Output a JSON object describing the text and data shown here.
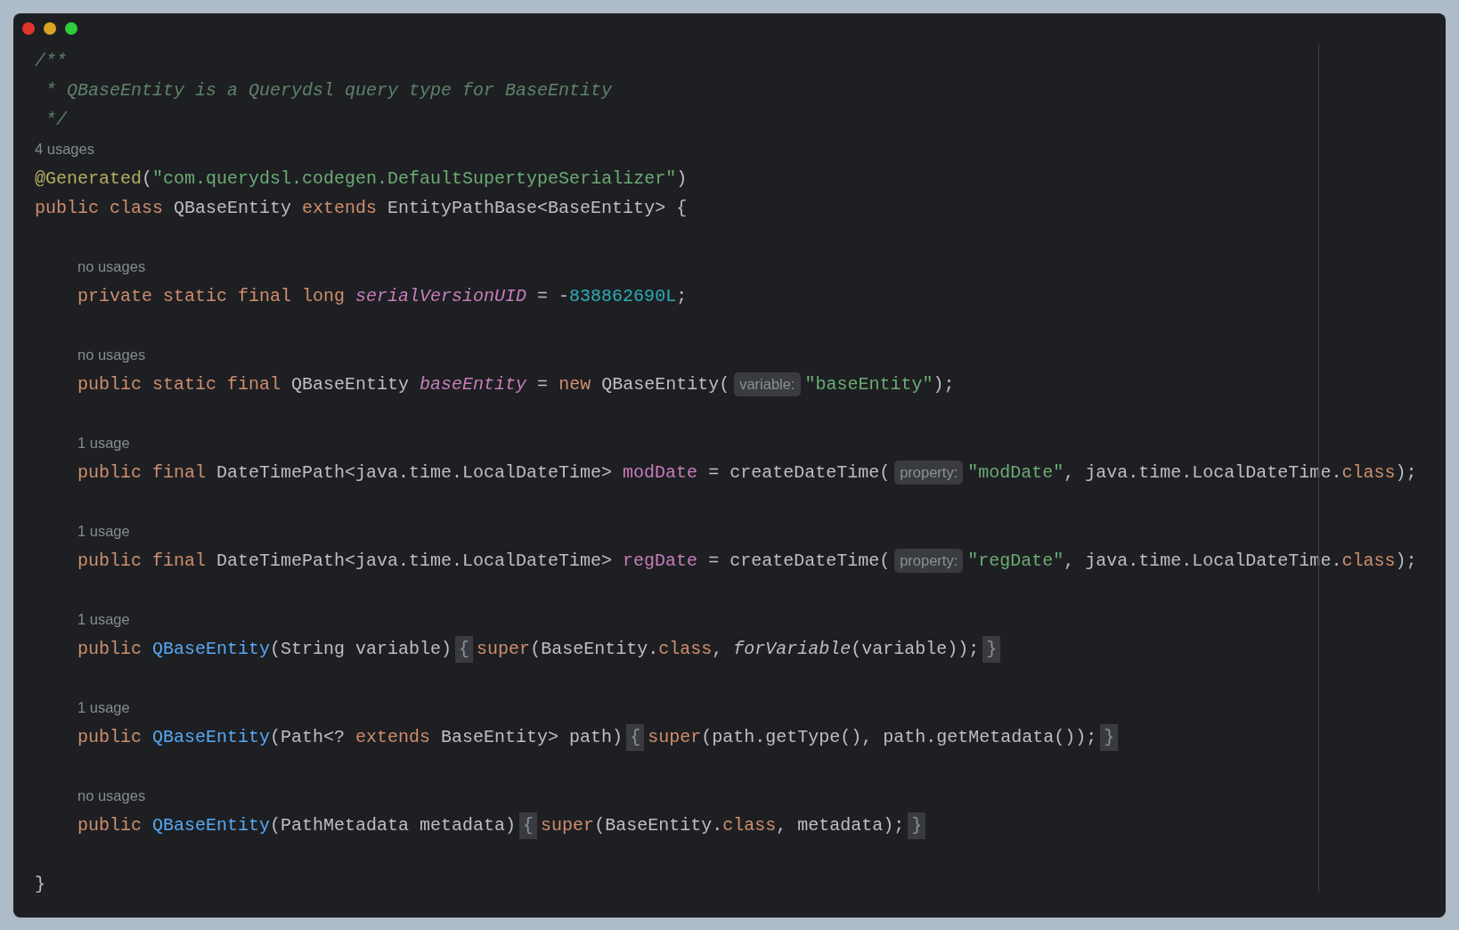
{
  "window": {
    "controls": [
      {
        "color": "#e0352b"
      },
      {
        "color": "#d9a521"
      },
      {
        "color": "#2fcc3b"
      }
    ]
  },
  "header": [
    {
      "kind": "code",
      "tokens": [
        {
          "kind": "cmt",
          "t": "/**"
        }
      ]
    },
    {
      "kind": "code",
      "tokens": [
        {
          "kind": "cmt",
          "t": " * QBaseEntity is a Querydsl query type for BaseEntity"
        }
      ]
    },
    {
      "kind": "code",
      "tokens": [
        {
          "kind": "cmt",
          "t": " */"
        }
      ]
    },
    {
      "kind": "usage",
      "text": "4 usages"
    },
    {
      "kind": "code",
      "tokens": [
        {
          "kind": "ann",
          "t": "@Generated"
        },
        {
          "kind": "plain",
          "t": "("
        },
        {
          "kind": "str",
          "t": "\"com.querydsl.codegen.DefaultSupertypeSerializer\""
        },
        {
          "kind": "plain",
          "t": ")"
        }
      ]
    },
    {
      "kind": "code",
      "tokens": [
        {
          "kind": "kw",
          "t": "public class "
        },
        {
          "kind": "plain",
          "t": "QBaseEntity "
        },
        {
          "kind": "kw",
          "t": "extends "
        },
        {
          "kind": "plain",
          "t": "EntityPathBase<BaseEntity> {"
        }
      ]
    }
  ],
  "body": [
    {
      "kind": "blank"
    },
    {
      "kind": "usage",
      "text": "no usages"
    },
    {
      "kind": "code",
      "tokens": [
        {
          "kind": "kw",
          "t": "private static final long "
        },
        {
          "kind": "sfield",
          "t": "serialVersionUID"
        },
        {
          "kind": "plain",
          "t": " = -"
        },
        {
          "kind": "num",
          "t": "838862690L"
        },
        {
          "kind": "plain",
          "t": ";"
        }
      ]
    },
    {
      "kind": "blank"
    },
    {
      "kind": "usage",
      "text": "no usages"
    },
    {
      "kind": "code",
      "tokens": [
        {
          "kind": "kw",
          "t": "public static final "
        },
        {
          "kind": "plain",
          "t": "QBaseEntity "
        },
        {
          "kind": "sfield",
          "t": "baseEntity"
        },
        {
          "kind": "plain",
          "t": " = "
        },
        {
          "kind": "kw",
          "t": "new "
        },
        {
          "kind": "plain",
          "t": "QBaseEntity("
        },
        {
          "kind": "hint",
          "t": "variable:"
        },
        {
          "kind": "str",
          "t": "\"baseEntity\""
        },
        {
          "kind": "plain",
          "t": ");"
        }
      ]
    },
    {
      "kind": "blank"
    },
    {
      "kind": "usage",
      "text": "1 usage"
    },
    {
      "kind": "code",
      "tokens": [
        {
          "kind": "kw",
          "t": "public final "
        },
        {
          "kind": "plain",
          "t": "DateTimePath<java.time.LocalDateTime> "
        },
        {
          "kind": "field",
          "t": "modDate"
        },
        {
          "kind": "plain",
          "t": " = createDateTime("
        },
        {
          "kind": "hint",
          "t": "property:"
        },
        {
          "kind": "str",
          "t": "\"modDate\""
        },
        {
          "kind": "plain",
          "t": ", java.time.LocalDateTime."
        },
        {
          "kind": "kw",
          "t": "class"
        },
        {
          "kind": "plain",
          "t": ");"
        }
      ]
    },
    {
      "kind": "blank"
    },
    {
      "kind": "usage",
      "text": "1 usage"
    },
    {
      "kind": "code",
      "tokens": [
        {
          "kind": "kw",
          "t": "public final "
        },
        {
          "kind": "plain",
          "t": "DateTimePath<java.time.LocalDateTime> "
        },
        {
          "kind": "field",
          "t": "regDate"
        },
        {
          "kind": "plain",
          "t": " = createDateTime("
        },
        {
          "kind": "hint",
          "t": "property:"
        },
        {
          "kind": "str",
          "t": "\"regDate\""
        },
        {
          "kind": "plain",
          "t": ", java.time.LocalDateTime."
        },
        {
          "kind": "kw",
          "t": "class"
        },
        {
          "kind": "plain",
          "t": ");"
        }
      ]
    },
    {
      "kind": "blank"
    },
    {
      "kind": "usage",
      "text": "1 usage"
    },
    {
      "kind": "code",
      "tokens": [
        {
          "kind": "kw",
          "t": "public "
        },
        {
          "kind": "decl",
          "t": "QBaseEntity"
        },
        {
          "kind": "plain",
          "t": "(String variable)"
        },
        {
          "kind": "fold",
          "t": "{"
        },
        {
          "kind": "kw",
          "t": "super"
        },
        {
          "kind": "plain",
          "t": "(BaseEntity."
        },
        {
          "kind": "kw",
          "t": "class"
        },
        {
          "kind": "plain",
          "t": ", "
        },
        {
          "kind": "ital",
          "t": "forVariable"
        },
        {
          "kind": "plain",
          "t": "(variable));"
        },
        {
          "kind": "fold",
          "t": "}"
        }
      ]
    },
    {
      "kind": "blank"
    },
    {
      "kind": "usage",
      "text": "1 usage"
    },
    {
      "kind": "code",
      "tokens": [
        {
          "kind": "kw",
          "t": "public "
        },
        {
          "kind": "decl",
          "t": "QBaseEntity"
        },
        {
          "kind": "plain",
          "t": "(Path<? "
        },
        {
          "kind": "kw",
          "t": "extends "
        },
        {
          "kind": "plain",
          "t": "BaseEntity> path)"
        },
        {
          "kind": "fold",
          "t": "{"
        },
        {
          "kind": "kw",
          "t": "super"
        },
        {
          "kind": "plain",
          "t": "(path.getType(), path.getMetadata());"
        },
        {
          "kind": "fold",
          "t": "}"
        }
      ]
    },
    {
      "kind": "blank"
    },
    {
      "kind": "usage",
      "text": "no usages"
    },
    {
      "kind": "code",
      "tokens": [
        {
          "kind": "kw",
          "t": "public "
        },
        {
          "kind": "decl",
          "t": "QBaseEntity"
        },
        {
          "kind": "plain",
          "t": "(PathMetadata metadata)"
        },
        {
          "kind": "fold",
          "t": "{"
        },
        {
          "kind": "kw",
          "t": "super"
        },
        {
          "kind": "plain",
          "t": "(BaseEntity."
        },
        {
          "kind": "kw",
          "t": "class"
        },
        {
          "kind": "plain",
          "t": ", metadata);"
        },
        {
          "kind": "fold",
          "t": "}"
        }
      ]
    },
    {
      "kind": "blank"
    }
  ],
  "footer": [
    {
      "kind": "code",
      "tokens": [
        {
          "kind": "plain",
          "t": "}"
        }
      ]
    }
  ]
}
